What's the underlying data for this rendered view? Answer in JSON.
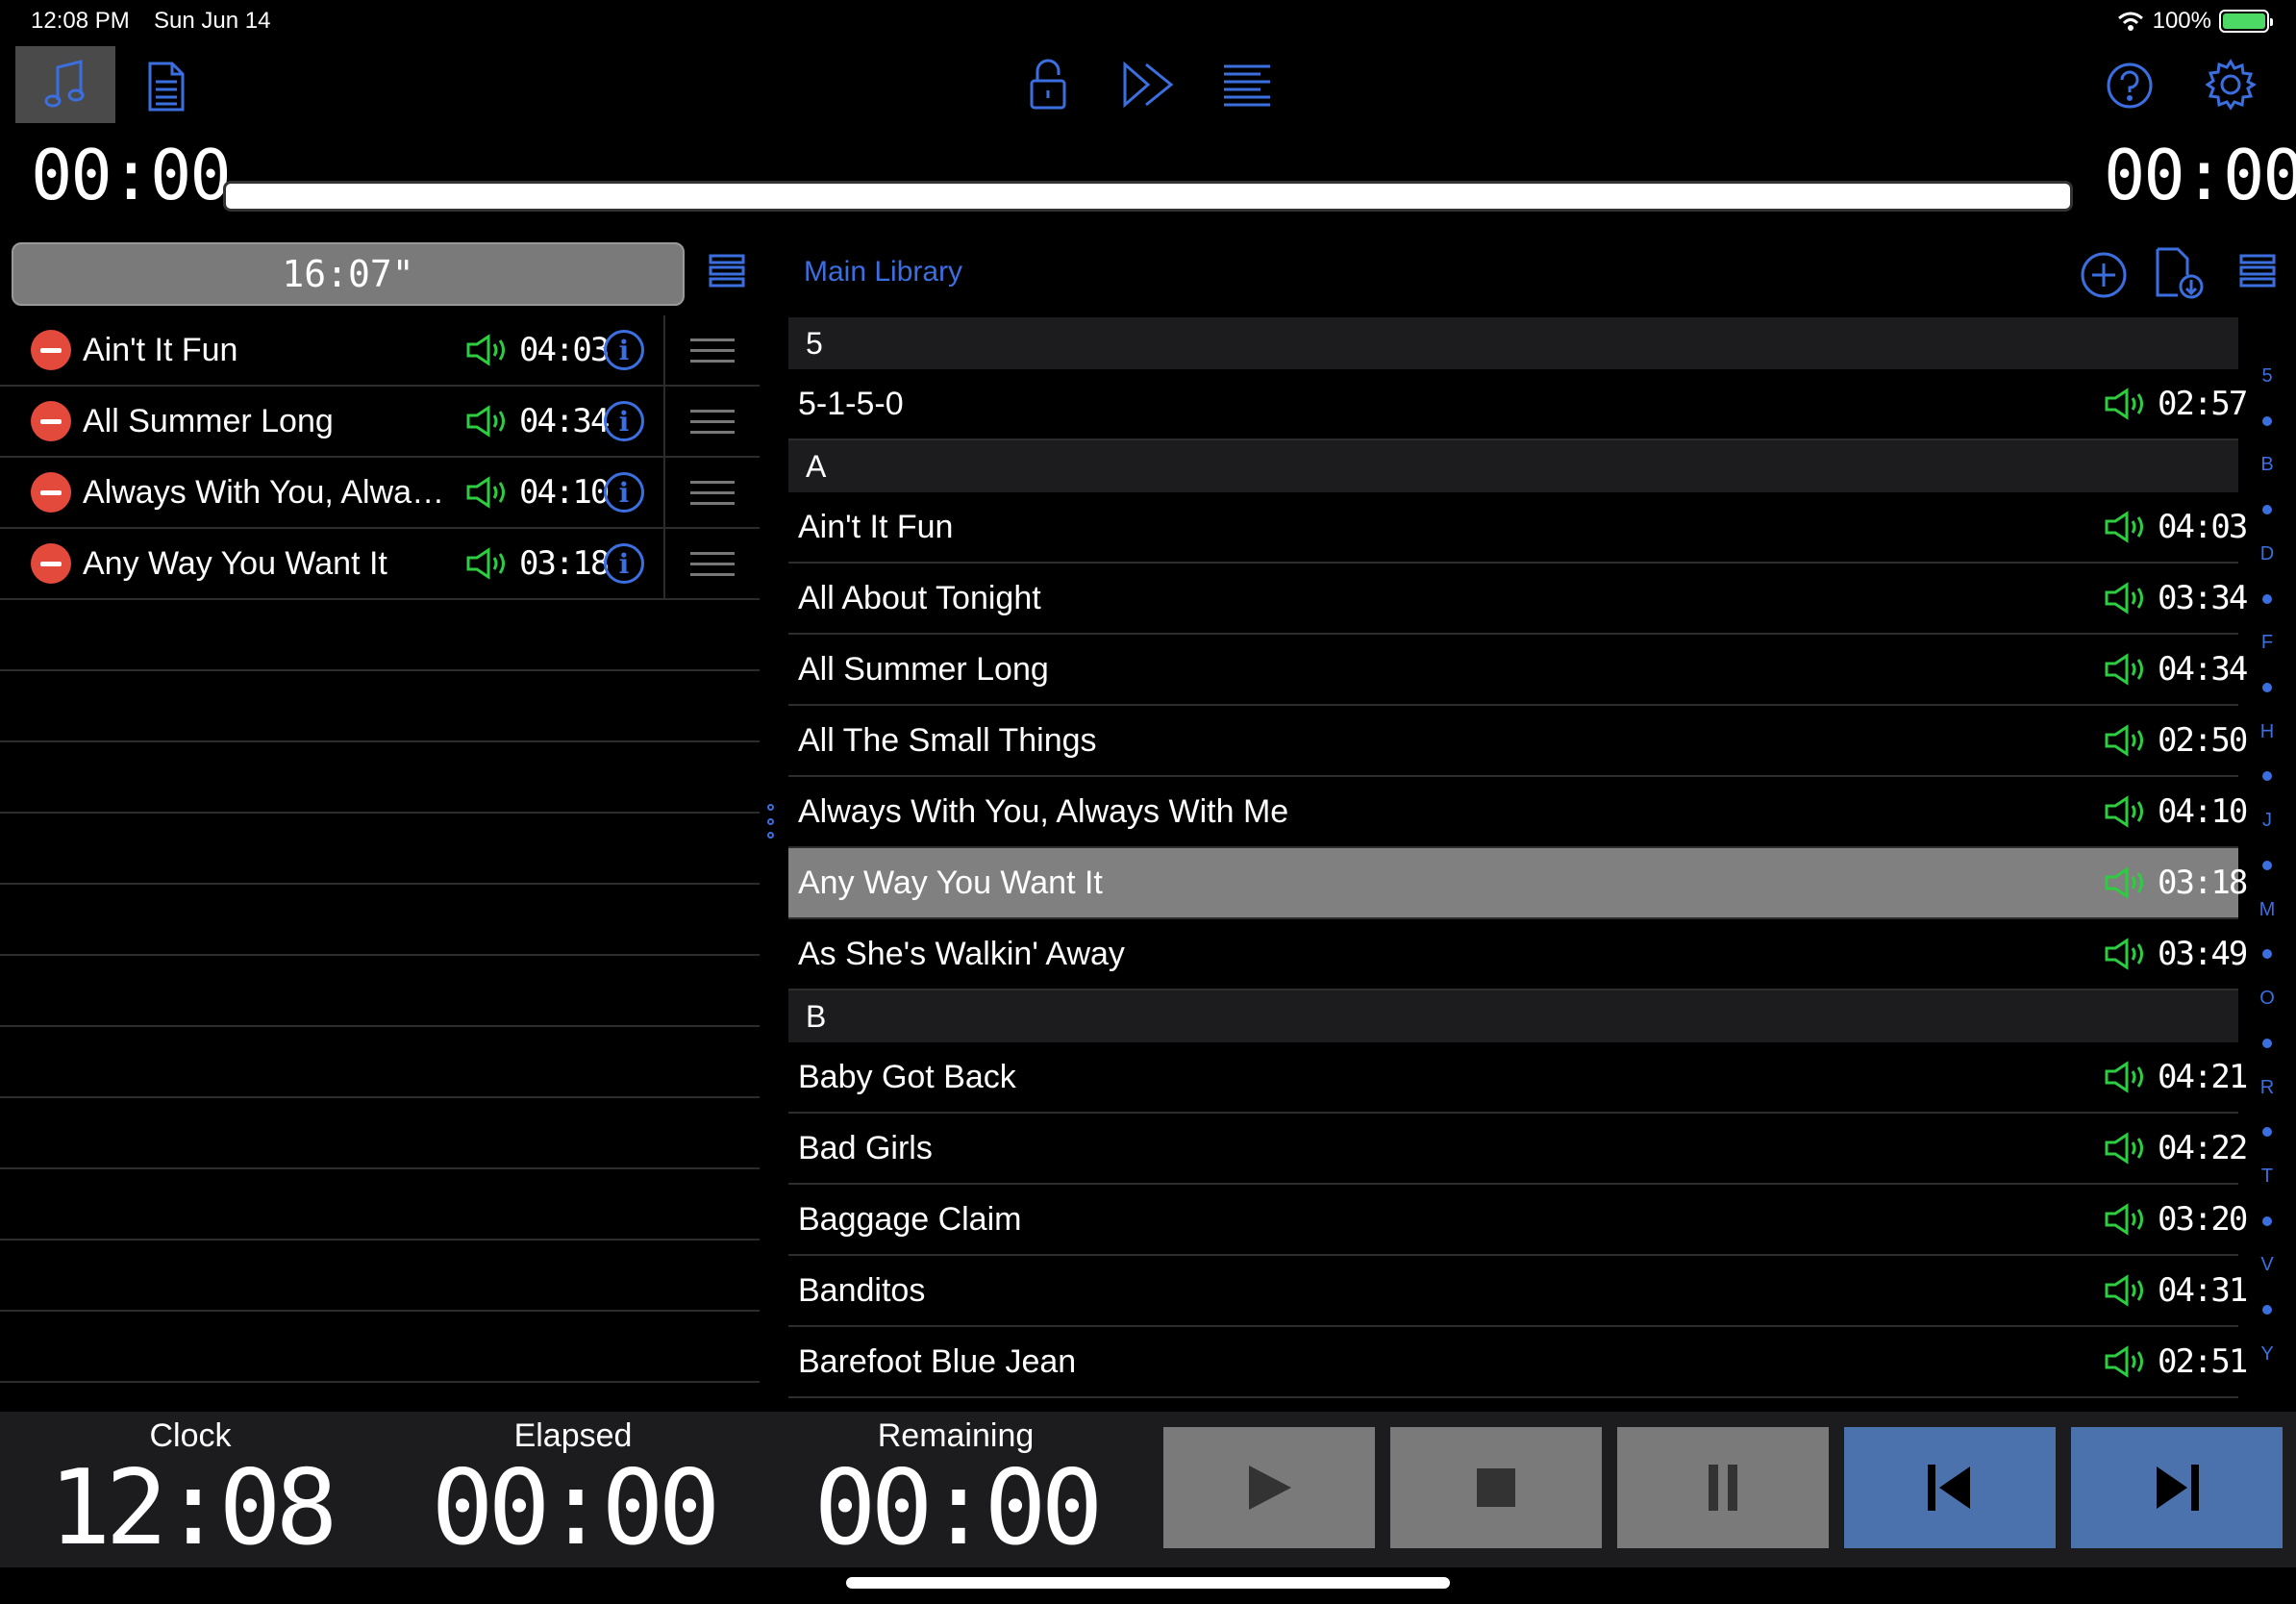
{
  "status_bar": {
    "time": "12:08 PM",
    "date": "Sun Jun 14",
    "battery": "100%"
  },
  "toolbar": {
    "icons": [
      "music-note-icon",
      "document-icon",
      "lock-icon",
      "fast-forward-icon",
      "align-icon",
      "help-icon",
      "gear-icon"
    ]
  },
  "timers": {
    "elapsed": "00:00",
    "remaining": "00:00"
  },
  "setlist": {
    "total": "16:07\"",
    "items": [
      {
        "title": "Ain't It Fun",
        "duration": "04:03"
      },
      {
        "title": "All Summer Long",
        "duration": "04:34"
      },
      {
        "title": "Always With You, Always With Me",
        "duration": "04:10"
      },
      {
        "title": "Any Way You Want It",
        "duration": "03:18"
      }
    ]
  },
  "library": {
    "title": "Main Library",
    "sections": [
      {
        "header": "5",
        "items": [
          {
            "title": "5-1-5-0",
            "duration": "02:57"
          }
        ]
      },
      {
        "header": "A",
        "items": [
          {
            "title": "Ain't It Fun",
            "duration": "04:03"
          },
          {
            "title": "All About Tonight",
            "duration": "03:34"
          },
          {
            "title": "All Summer Long",
            "duration": "04:34"
          },
          {
            "title": "All The Small Things",
            "duration": "02:50"
          },
          {
            "title": "Always With You, Always With Me",
            "duration": "04:10"
          },
          {
            "title": "Any Way You Want It",
            "duration": "03:18",
            "selected": true
          },
          {
            "title": "As She's Walkin' Away",
            "duration": "03:49"
          }
        ]
      },
      {
        "header": "B",
        "items": [
          {
            "title": "Baby Got Back",
            "duration": "04:21"
          },
          {
            "title": "Bad Girls",
            "duration": "04:22"
          },
          {
            "title": "Baggage Claim",
            "duration": "03:20"
          },
          {
            "title": "Banditos",
            "duration": "04:31"
          },
          {
            "title": "Barefoot Blue Jean",
            "duration": "02:51"
          }
        ]
      }
    ],
    "index": [
      "5",
      "B",
      "D",
      "F",
      "H",
      "J",
      "M",
      "O",
      "R",
      "T",
      "V",
      "Y"
    ]
  },
  "bottom": {
    "clock_label": "Clock",
    "clock_value": "12:08",
    "elapsed_label": "Elapsed",
    "elapsed_value": "00:00",
    "remaining_label": "Remaining",
    "remaining_value": "00:00"
  },
  "colors": {
    "accent": "#3b6fe0",
    "speaker": "#2ecc40",
    "remove": "#e34a3c",
    "control_blue": "#4b72ad",
    "control_gray": "#7a7a7a"
  }
}
